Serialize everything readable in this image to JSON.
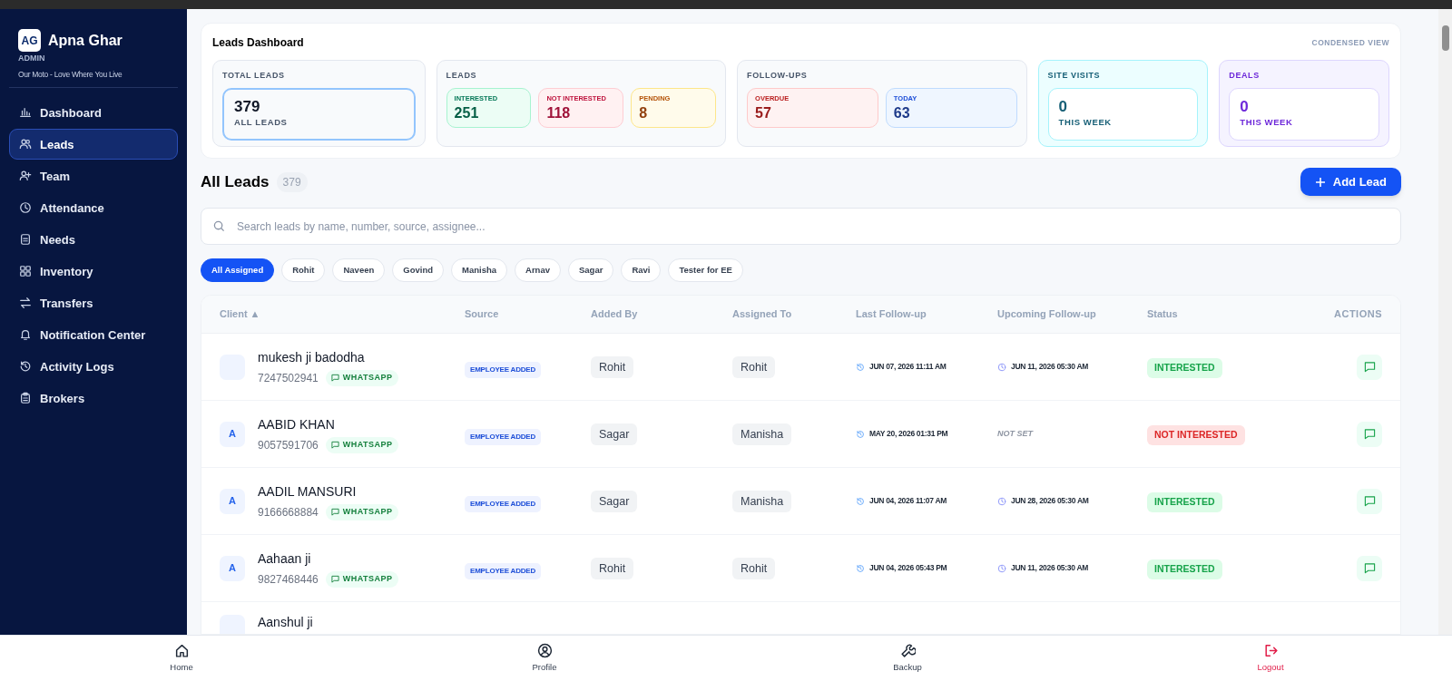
{
  "brand": {
    "logo": "AG",
    "name": "Apna Ghar",
    "role": "ADMIN",
    "motto": "Our Moto - Love Where You Live"
  },
  "nav": [
    {
      "label": "Dashboard",
      "selected": false
    },
    {
      "label": "Leads",
      "selected": true
    },
    {
      "label": "Team",
      "selected": false
    },
    {
      "label": "Attendance",
      "selected": false
    },
    {
      "label": "Needs",
      "selected": false
    },
    {
      "label": "Inventory",
      "selected": false
    },
    {
      "label": "Transfers",
      "selected": false
    },
    {
      "label": "Notification Center",
      "selected": false
    },
    {
      "label": "Activity Logs",
      "selected": false
    },
    {
      "label": "Brokers",
      "selected": false
    }
  ],
  "dashboard": {
    "title": "Leads Dashboard",
    "view_toggle": "CONDENSED VIEW",
    "groups": [
      {
        "label": "TOTAL LEADS",
        "tiles": [
          {
            "kind": "big",
            "value": "379",
            "caption": "ALL LEADS"
          }
        ]
      },
      {
        "label": "LEADS",
        "tiles": [
          {
            "kind": "small",
            "caption": "INTERESTED",
            "value": "251"
          },
          {
            "kind": "small",
            "caption": "NOT INTERESTED",
            "value": "118"
          },
          {
            "kind": "small",
            "caption": "PENDING",
            "value": "8"
          }
        ]
      },
      {
        "label": "FOLLOW-UPS",
        "tiles": [
          {
            "kind": "small",
            "caption": "OVERDUE",
            "value": "57"
          },
          {
            "kind": "small",
            "caption": "TODAY",
            "value": "63"
          }
        ]
      },
      {
        "label": "SITE VISITS",
        "tiles": [
          {
            "kind": "big",
            "value": "0",
            "caption": "THIS WEEK"
          }
        ]
      },
      {
        "label": "DEALS",
        "tiles": [
          {
            "kind": "big",
            "value": "0",
            "caption": "THIS WEEK"
          }
        ]
      }
    ]
  },
  "leads": {
    "title": "All Leads",
    "count": "379",
    "add_button": "Add Lead",
    "search": {
      "placeholder": "Search leads by name, number, source, assignee..."
    },
    "filters": [
      {
        "label": "All Assigned",
        "selected": true
      },
      {
        "label": "Rohit",
        "selected": false
      },
      {
        "label": "Naveen",
        "selected": false
      },
      {
        "label": "Govind",
        "selected": false
      },
      {
        "label": "Manisha",
        "selected": false
      },
      {
        "label": "Arnav",
        "selected": false
      },
      {
        "label": "Sagar",
        "selected": false
      },
      {
        "label": "Ravi",
        "selected": false
      },
      {
        "label": "Tester for EE",
        "selected": false
      }
    ],
    "columns": [
      "Client ▲",
      "Source",
      "Added By",
      "Assigned To",
      "Last Follow-up",
      "Upcoming Follow-up",
      "Status",
      "ACTIONS"
    ],
    "rows": [
      {
        "initial": "",
        "name": "mukesh ji badodha",
        "phone": "7247502941",
        "channel": "WHATSAPP",
        "source": "EMPLOYEE ADDED",
        "added_by": "Rohit",
        "assigned_to": "Rohit",
        "last_followup": "JUN 07, 2026 11:11 AM",
        "upcoming": {
          "kind": "date",
          "text": "JUN 11, 2026 05:30 AM"
        },
        "status": {
          "kind": "interested",
          "text": "INTERESTED"
        }
      },
      {
        "initial": "A",
        "name": "AABID KHAN",
        "phone": "9057591706",
        "channel": "WHATSAPP",
        "source": "EMPLOYEE ADDED",
        "added_by": "Sagar",
        "assigned_to": "Manisha",
        "last_followup": "MAY 20, 2026 01:31 PM",
        "upcoming": {
          "kind": "unset",
          "text": "NOT SET"
        },
        "status": {
          "kind": "not_interested",
          "text": "NOT INTERESTED"
        }
      },
      {
        "initial": "A",
        "name": "AADIL MANSURI",
        "phone": "9166668884",
        "channel": "WHATSAPP",
        "source": "EMPLOYEE ADDED",
        "added_by": "Sagar",
        "assigned_to": "Manisha",
        "last_followup": "JUN 04, 2026 11:07 AM",
        "upcoming": {
          "kind": "date",
          "text": "JUN 28, 2026 05:30 AM"
        },
        "status": {
          "kind": "interested",
          "text": "INTERESTED"
        }
      },
      {
        "initial": "A",
        "name": "Aahaan ji",
        "phone": "9827468446",
        "channel": "WHATSAPP",
        "source": "EMPLOYEE ADDED",
        "added_by": "Rohit",
        "assigned_to": "Rohit",
        "last_followup": "JUN 04, 2026 05:43 PM",
        "upcoming": {
          "kind": "date",
          "text": "JUN 11, 2026 05:30 AM"
        },
        "status": {
          "kind": "interested",
          "text": "INTERESTED"
        }
      }
    ],
    "partial_row": {
      "name": "Aanshul ji"
    }
  },
  "bottom_nav": [
    {
      "label": "Home",
      "kind": "normal"
    },
    {
      "label": "Profile",
      "kind": "normal"
    },
    {
      "label": "Backup",
      "kind": "normal"
    },
    {
      "label": "Logout",
      "kind": "danger"
    }
  ]
}
